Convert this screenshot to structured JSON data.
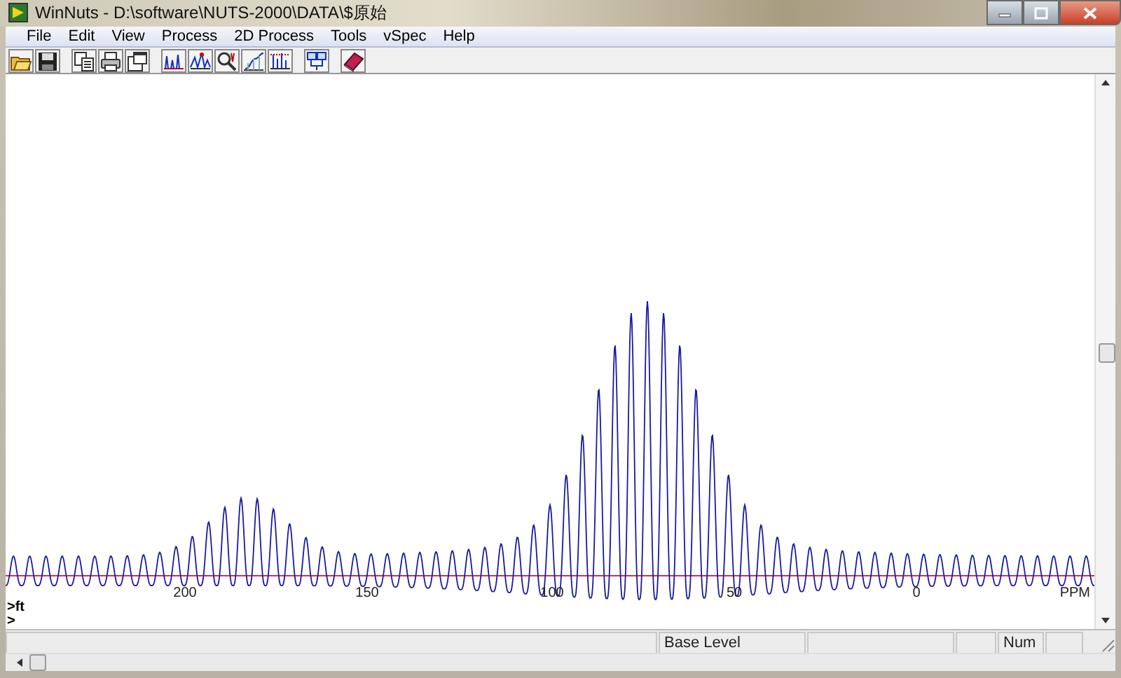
{
  "window": {
    "title": "WinNuts - D:\\software\\NUTS-2000\\DATA\\$原始"
  },
  "menu": [
    "File",
    "Edit",
    "View",
    "Process",
    "2D Process",
    "Tools",
    "vSpec",
    "Help"
  ],
  "spectrum": {
    "axis_labels": [
      "200",
      "150",
      "100",
      "50",
      "0"
    ],
    "unit": "PPM"
  },
  "command_lines": [
    ">ft",
    ">"
  ],
  "status_bar": [
    "Base Level",
    "Num"
  ]
}
